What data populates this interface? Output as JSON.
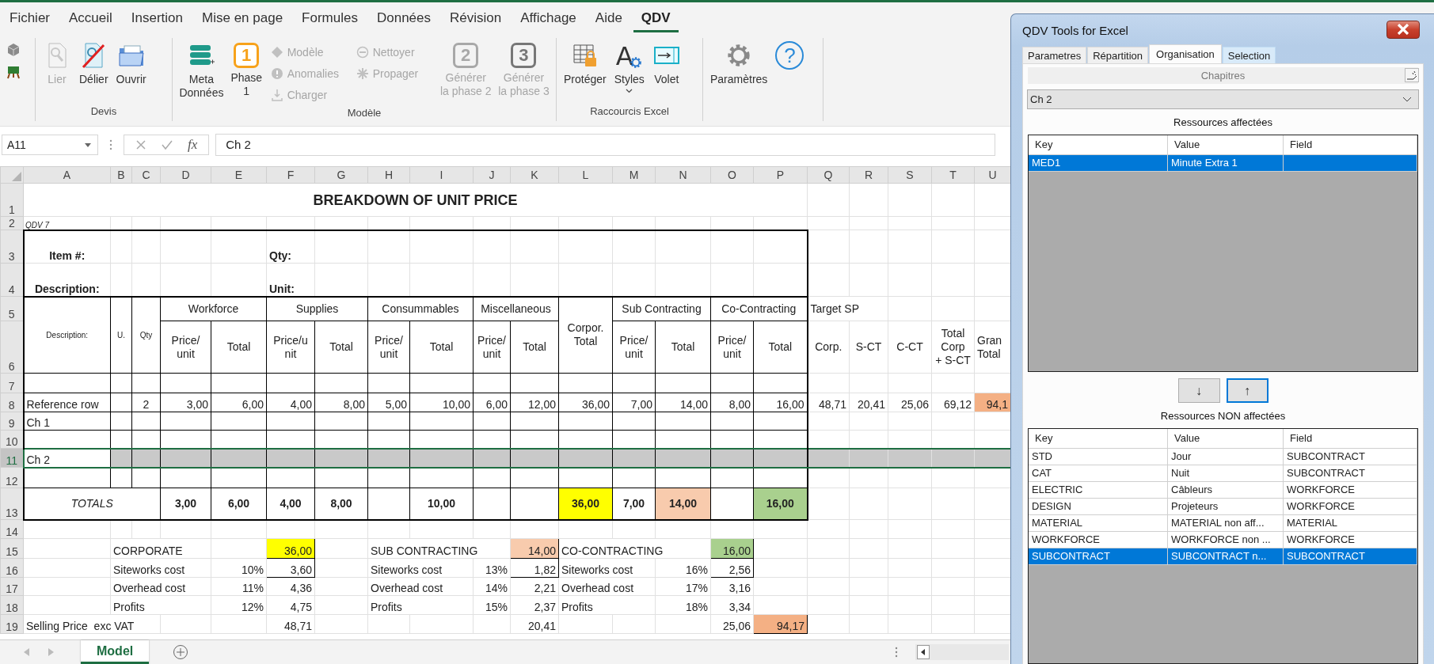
{
  "ribbon_tabs": [
    {
      "label": "Fichier",
      "selected": false
    },
    {
      "label": "Accueil",
      "selected": false
    },
    {
      "label": "Insertion",
      "selected": false
    },
    {
      "label": "Mise en page",
      "selected": false
    },
    {
      "label": "Formules",
      "selected": false
    },
    {
      "label": "Données",
      "selected": false
    },
    {
      "label": "Révision",
      "selected": false
    },
    {
      "label": "Affichage",
      "selected": false
    },
    {
      "label": "Aide",
      "selected": false
    },
    {
      "label": "QDV",
      "selected": true
    }
  ],
  "ribbon_groups": [
    {
      "buttons": [
        {
          "kind": "tiny",
          "disabled": false
        },
        {
          "kind": "tiny",
          "disabled": false
        }
      ]
    },
    {
      "label": "Devis",
      "buttons": [
        {
          "kind": "large",
          "label": "Lier",
          "disabled": true
        },
        {
          "kind": "large",
          "label": "Délier",
          "disabled": false
        },
        {
          "kind": "large",
          "label": "Ouvrir",
          "disabled": false
        }
      ]
    },
    {
      "label": "Modèle",
      "buttons": [
        {
          "kind": "large",
          "label": "Meta\nDonnées",
          "disabled": false
        },
        {
          "kind": "large",
          "label": "Phase\n1",
          "glyph": "1",
          "disabled": false
        },
        {
          "kind": "small",
          "label": "Modèle",
          "disabled": true
        },
        {
          "kind": "small",
          "label": "Anomalies",
          "disabled": true
        },
        {
          "kind": "small",
          "label": "Charger",
          "disabled": true
        },
        {
          "kind": "small",
          "label": "Nettoyer",
          "disabled": true
        },
        {
          "kind": "small",
          "label": "Propager",
          "disabled": true
        },
        {
          "kind": "large",
          "label": "Générer\nla phase 2",
          "glyph": "2",
          "disabled": true
        },
        {
          "kind": "large",
          "label": "Générer\nla phase 3",
          "glyph": "3",
          "disabled": true
        }
      ]
    },
    {
      "label": "Raccourcis Excel",
      "buttons": [
        {
          "kind": "large",
          "label": "Protéger",
          "disabled": false
        },
        {
          "kind": "large",
          "label": "Styles",
          "glyph": "A",
          "dropdown": true,
          "disabled": false
        },
        {
          "kind": "large",
          "label": "Volet",
          "disabled": false
        }
      ]
    },
    {
      "buttons": [
        {
          "kind": "large",
          "label": "Paramètres",
          "disabled": false
        },
        {
          "kind": "large",
          "glyph": "?",
          "disabled": false
        }
      ]
    }
  ],
  "formula_bar": {
    "name_box": "A11",
    "function_label": "fx",
    "value": "Ch 2"
  },
  "sheet": {
    "columns": [
      "A",
      "B",
      "C",
      "D",
      "E",
      "F",
      "G",
      "H",
      "I",
      "J",
      "K",
      "L",
      "M",
      "N",
      "O",
      "P",
      "Q",
      "R",
      "S",
      "T",
      "U"
    ],
    "rows": [
      {
        "number": "1",
        "selected": false,
        "shaded": false,
        "cells": [
          {
            "text": "BREAKDOWN OF UNIT PRICE",
            "bold": true
          }
        ]
      },
      {
        "number": "2",
        "selected": false,
        "shaded": false,
        "cells": [
          {
            "text": "QDV 7",
            "italic": true
          }
        ]
      },
      {
        "number": "3",
        "selected": false,
        "shaded": false,
        "cells": [
          {
            "text": "Item #:",
            "bold": true
          },
          "",
          "",
          "",
          "",
          {
            "text": "Qty:",
            "bold": true
          }
        ]
      },
      {
        "number": "4",
        "selected": false,
        "shaded": false,
        "cells": [
          {
            "text": "Description:",
            "bold": true
          },
          "",
          "",
          "",
          "",
          {
            "text": "Unit:",
            "bold": true
          }
        ]
      },
      {
        "number": "5",
        "selected": false,
        "shaded": false,
        "cells": [
          "Description:",
          "U.",
          "Qty",
          "Workforce",
          "",
          "Supplies",
          "",
          "Consummables",
          "",
          "Miscellaneous",
          "",
          "Corpor.\nTotal",
          "Sub Contracting",
          "",
          "Co-Contracting",
          "",
          "Target SP"
        ]
      },
      {
        "number": "6",
        "selected": false,
        "shaded": false,
        "cells": [
          "",
          "",
          "",
          "Price/\nunit",
          "Total",
          "Price/u\nnit",
          "Total",
          "Price/\nunit",
          "Total",
          "Price/\nunit",
          "Total",
          "",
          "Price/\nunit",
          "Total",
          "Price/\nunit",
          "Total",
          "Corp.",
          "S-CT",
          "C-CT",
          "Total\nCorp\n+ S-CT",
          "Gran\nTotal"
        ]
      },
      {
        "number": "7",
        "selected": false,
        "shaded": false
      },
      {
        "number": "8",
        "selected": false,
        "shaded": false,
        "cells": [
          "Reference row",
          "",
          "2",
          "3,00",
          "6,00",
          "4,00",
          "8,00",
          "5,00",
          "10,00",
          "6,00",
          "12,00",
          "36,00",
          "7,00",
          "14,00",
          "8,00",
          "16,00",
          "48,71",
          "20,41",
          "25,06",
          "69,12",
          {
            "text": "94,1",
            "color": "#f4b084"
          }
        ]
      },
      {
        "number": "9",
        "selected": false,
        "shaded": false,
        "cells": [
          "Ch 1"
        ]
      },
      {
        "number": "10",
        "selected": false,
        "shaded": false
      },
      {
        "number": "11",
        "selected": true,
        "shaded": true,
        "cells": [
          "Ch 2"
        ]
      },
      {
        "number": "12",
        "selected": false,
        "shaded": false
      },
      {
        "number": "13",
        "selected": false,
        "shaded": false,
        "cells": [
          {
            "text": "TOTALS",
            "italic": true
          },
          "",
          "",
          {
            "text": "3,00",
            "bold": true
          },
          {
            "text": "6,00",
            "bold": true
          },
          {
            "text": "4,00",
            "bold": true
          },
          {
            "text": "8,00",
            "bold": true
          },
          "",
          {
            "text": "10,00",
            "bold": true
          },
          "",
          "",
          {
            "text": "36,00",
            "bold": true,
            "color": "#ffff00"
          },
          {
            "text": "7,00",
            "bold": true
          },
          {
            "text": "14,00",
            "bold": true,
            "color": "#f8cbad"
          },
          "",
          {
            "text": "16,00",
            "bold": true,
            "color": "#a9d08e"
          }
        ]
      },
      {
        "number": "14",
        "selected": false,
        "shaded": false
      },
      {
        "number": "15",
        "selected": false,
        "shaded": false,
        "cells": [
          "",
          "CORPORATE",
          "",
          "",
          "",
          {
            "text": "36,00",
            "color": "#ffff00",
            "boxed": true
          },
          "",
          "SUB CONTRACTING",
          "",
          "",
          {
            "text": "14,00",
            "color": "#f8cbad",
            "boxed": true
          },
          "CO-CONTRACTING",
          "",
          "",
          {
            "text": "16,00",
            "color": "#a9d08e",
            "boxed": true
          }
        ]
      },
      {
        "number": "16",
        "selected": false,
        "shaded": false,
        "cells": [
          "",
          "Siteworks cost",
          "",
          "",
          "10%",
          {
            "text": "3,60",
            "boxed": true
          },
          "",
          "Siteworks cost",
          "",
          "13%",
          {
            "text": "1,82",
            "boxed": true
          },
          "Siteworks cost",
          "",
          "16%",
          {
            "text": "2,56",
            "boxed": true
          }
        ]
      },
      {
        "number": "17",
        "selected": false,
        "shaded": false,
        "cells": [
          "",
          "Overhead cost",
          "",
          "",
          "11%",
          "4,36",
          "",
          "Overhead cost",
          "",
          "14%",
          "2,21",
          "Overhead cost",
          "",
          "17%",
          "3,16"
        ]
      },
      {
        "number": "18",
        "selected": false,
        "shaded": false,
        "cells": [
          "",
          "Profits",
          "",
          "",
          "12%",
          "4,75",
          "",
          "Profits",
          "",
          "15%",
          "2,37",
          "Profits",
          "",
          "18%",
          "3,34"
        ]
      },
      {
        "number": "19",
        "selected": false,
        "shaded": false,
        "cells": [
          "Selling Price  exc VAT",
          "",
          "",
          "",
          "",
          "48,71",
          "",
          "",
          "",
          "",
          "20,41",
          "",
          "",
          "",
          "25,06",
          {
            "text": "94,17",
            "color": "#f4b084",
            "boxed": true
          }
        ]
      }
    ]
  },
  "sheet_tabs": [
    {
      "label": "Model",
      "selected": true
    }
  ],
  "panel": {
    "title": "QDV Tools for Excel",
    "tabs": [
      {
        "label": "Parametres",
        "selected": false,
        "hovered": false
      },
      {
        "label": "Répartition",
        "selected": false,
        "hovered": false
      },
      {
        "label": "Organisation",
        "selected": true,
        "hovered": false
      },
      {
        "label": "Selection",
        "selected": false,
        "hovered": true
      }
    ],
    "section_title": "Chapitres",
    "chapter": "Ch 2",
    "assigned_label": "Ressources affectées",
    "assigned": {
      "columns": [
        "Key",
        "Value",
        "Field"
      ],
      "rows": [
        {
          "cells": [
            "MED1",
            "Minute Extra 1"
          ],
          "selected": true
        }
      ]
    },
    "move_buttons": [
      {
        "label": "↓",
        "focused": false
      },
      {
        "label": "↑",
        "focused": true
      }
    ],
    "unassigned_label": "Ressources NON affectées",
    "unassigned": {
      "columns": [
        "Key",
        "Value",
        "Field"
      ],
      "rows": [
        {
          "cells": [
            "STD",
            "Jour",
            "SUBCONTRACT"
          ],
          "selected": false
        },
        {
          "cells": [
            "CAT",
            "Nuit",
            "SUBCONTRACT"
          ],
          "selected": false
        },
        {
          "cells": [
            "ELECTRIC",
            "Câbleurs",
            "WORKFORCE"
          ],
          "selected": false
        },
        {
          "cells": [
            "DESIGN",
            "Projeteurs",
            "WORKFORCE"
          ],
          "selected": false
        },
        {
          "cells": [
            "MATERIAL",
            "MATERIAL non aff...",
            "MATERIAL"
          ],
          "selected": false
        },
        {
          "cells": [
            "WORKFORCE",
            "WORKFORCE non ...",
            "WORKFORCE"
          ],
          "selected": false
        },
        {
          "cells": [
            "SUBCONTRACT",
            "SUBCONTRACT n...",
            "SUBCONTRACT"
          ],
          "selected": true
        }
      ]
    }
  }
}
